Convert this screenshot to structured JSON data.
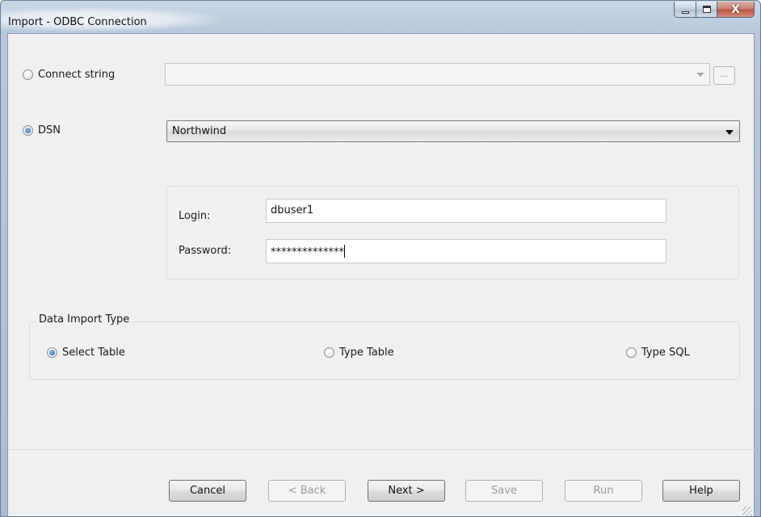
{
  "window": {
    "title": "Import - ODBC Connection",
    "controls": {
      "minimize_icon": "minimize-icon",
      "maximize_icon": "maximize-icon",
      "close_glyph": "X"
    }
  },
  "connection": {
    "connect_string": {
      "label": "Connect string",
      "selected": false,
      "value": "",
      "ellipsis_label": "..."
    },
    "dsn": {
      "label": "DSN",
      "selected": true,
      "value": "Northwind"
    }
  },
  "credentials": {
    "login_label": "Login:",
    "login_value": "dbuser1",
    "password_label": "Password:",
    "password_value": "**************"
  },
  "import_type": {
    "title": "Data Import Type",
    "options": [
      {
        "label": "Select Table",
        "selected": true
      },
      {
        "label": "Type Table",
        "selected": false
      },
      {
        "label": "Type SQL",
        "selected": false
      }
    ]
  },
  "buttons": {
    "cancel": "Cancel",
    "back": "< Back",
    "next": "Next >",
    "save": "Save",
    "run": "Run",
    "help": "Help"
  },
  "colors": {
    "title_bar": "#b7c8dc",
    "client_bg": "#f0f0f0",
    "radio_dot": "#1f5fa6",
    "close_button": "#c77a6d"
  }
}
